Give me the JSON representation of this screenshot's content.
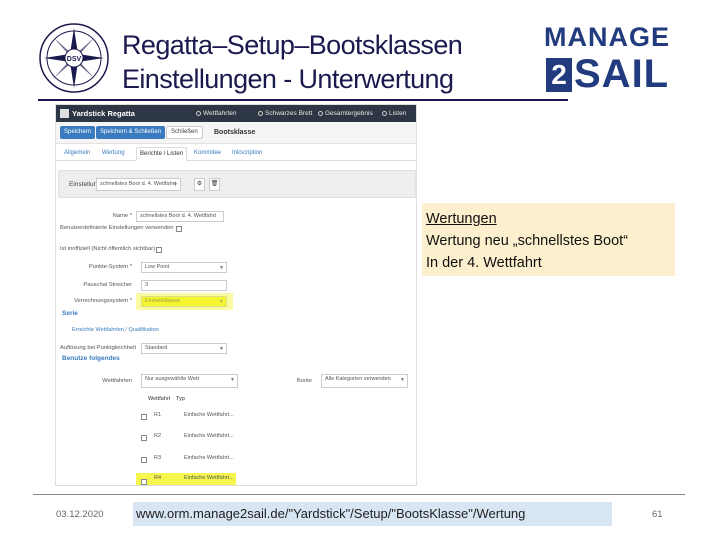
{
  "slide": {
    "title_line1": "Regatta–Setup–Bootsklassen",
    "title_line2": "Einstellungen - Unterwertung",
    "brand_top": "MANAGE",
    "brand_digit": "2",
    "brand_sail": "SAIL",
    "dsv_logo_text": "DSV"
  },
  "app": {
    "navbar": {
      "brand": "Yardstick Regatta",
      "items": [
        "Wettfahrten",
        "Schwarzes Brett",
        "Gesamtergebnis",
        "Listen"
      ]
    },
    "toolbar": {
      "save": "Speichern",
      "save_close": "Speichern & Schließen",
      "close": "Schließen",
      "title": "Bootsklasse"
    },
    "tabs": [
      "Allgemein",
      "Wertung",
      "Berichte / Listen",
      "Kommitee",
      "Inkscription"
    ],
    "settings": {
      "label": "Einstellung",
      "value": "schnellstes Boot d. 4. Wettfahrt"
    },
    "form": {
      "name_label": "Name *",
      "name_value": "schnellstes Boot d. 4. Wettfahrt",
      "custom_settings_label": "Benutzerdefinierte Einstellungen verwenden",
      "unofficial_label": "Ist inoffiziell (Nicht öffentlich sichtbar)",
      "points_system_label": "Punkte-System *",
      "points_system_value": "Low Point",
      "pauschal_label": "Pauschal Streicher",
      "pauschal_value": "3",
      "scoring_system_label": "Verrechnungssystem *",
      "scoring_system_value": "Einheitsklasse"
    },
    "serie": {
      "title": "Serie",
      "sub_link": "Erreichte Wettfahrten / Qualifikation",
      "tie_label": "Auflösung bei Punktgleichheit",
      "tie_value": "Standard",
      "use_following": "Benutze folgendes"
    },
    "races_filter": {
      "races_label": "Wettfahrten",
      "races_value": "Nur ausgewählte Wett",
      "boats_label": "Boote",
      "boats_value": "Alle Kategorien verwenden"
    },
    "races_table": {
      "headers": [
        "Wettfahrt",
        "Typ"
      ],
      "rows": [
        {
          "name": "R1",
          "type": "Einfache Wettfahrt..."
        },
        {
          "name": "R2",
          "type": "Einfache Wettfahrt..."
        },
        {
          "name": "R3",
          "type": "Einfache Wettfahrt..."
        },
        {
          "name": "R4",
          "type": "Einfache Wettfahrt..."
        }
      ]
    }
  },
  "callout": {
    "heading": "Wertungen",
    "line1": "Wertung neu „schnellstes Boot“",
    "line2": "In der 4. Wettfahrt"
  },
  "footer": {
    "date": "03.12.2020",
    "url": "www.orm.manage2sail.de/\"Yardstick\"/Setup/\"BootsKlasse\"/Wertung",
    "page": "61"
  },
  "colors": {
    "title": "#1b1a4e",
    "brand": "#223b7e",
    "highlight": "#f4f430",
    "callout_bg": "#fcefce",
    "url_bg": "#d8e5f2",
    "navbar_bg": "#2d3644",
    "primary_btn": "#3a7bbf"
  },
  "icons": [
    "compass-rose-icon",
    "settings-gear-icon",
    "trash-icon",
    "chevron-down-icon",
    "checkbox-icon"
  ]
}
